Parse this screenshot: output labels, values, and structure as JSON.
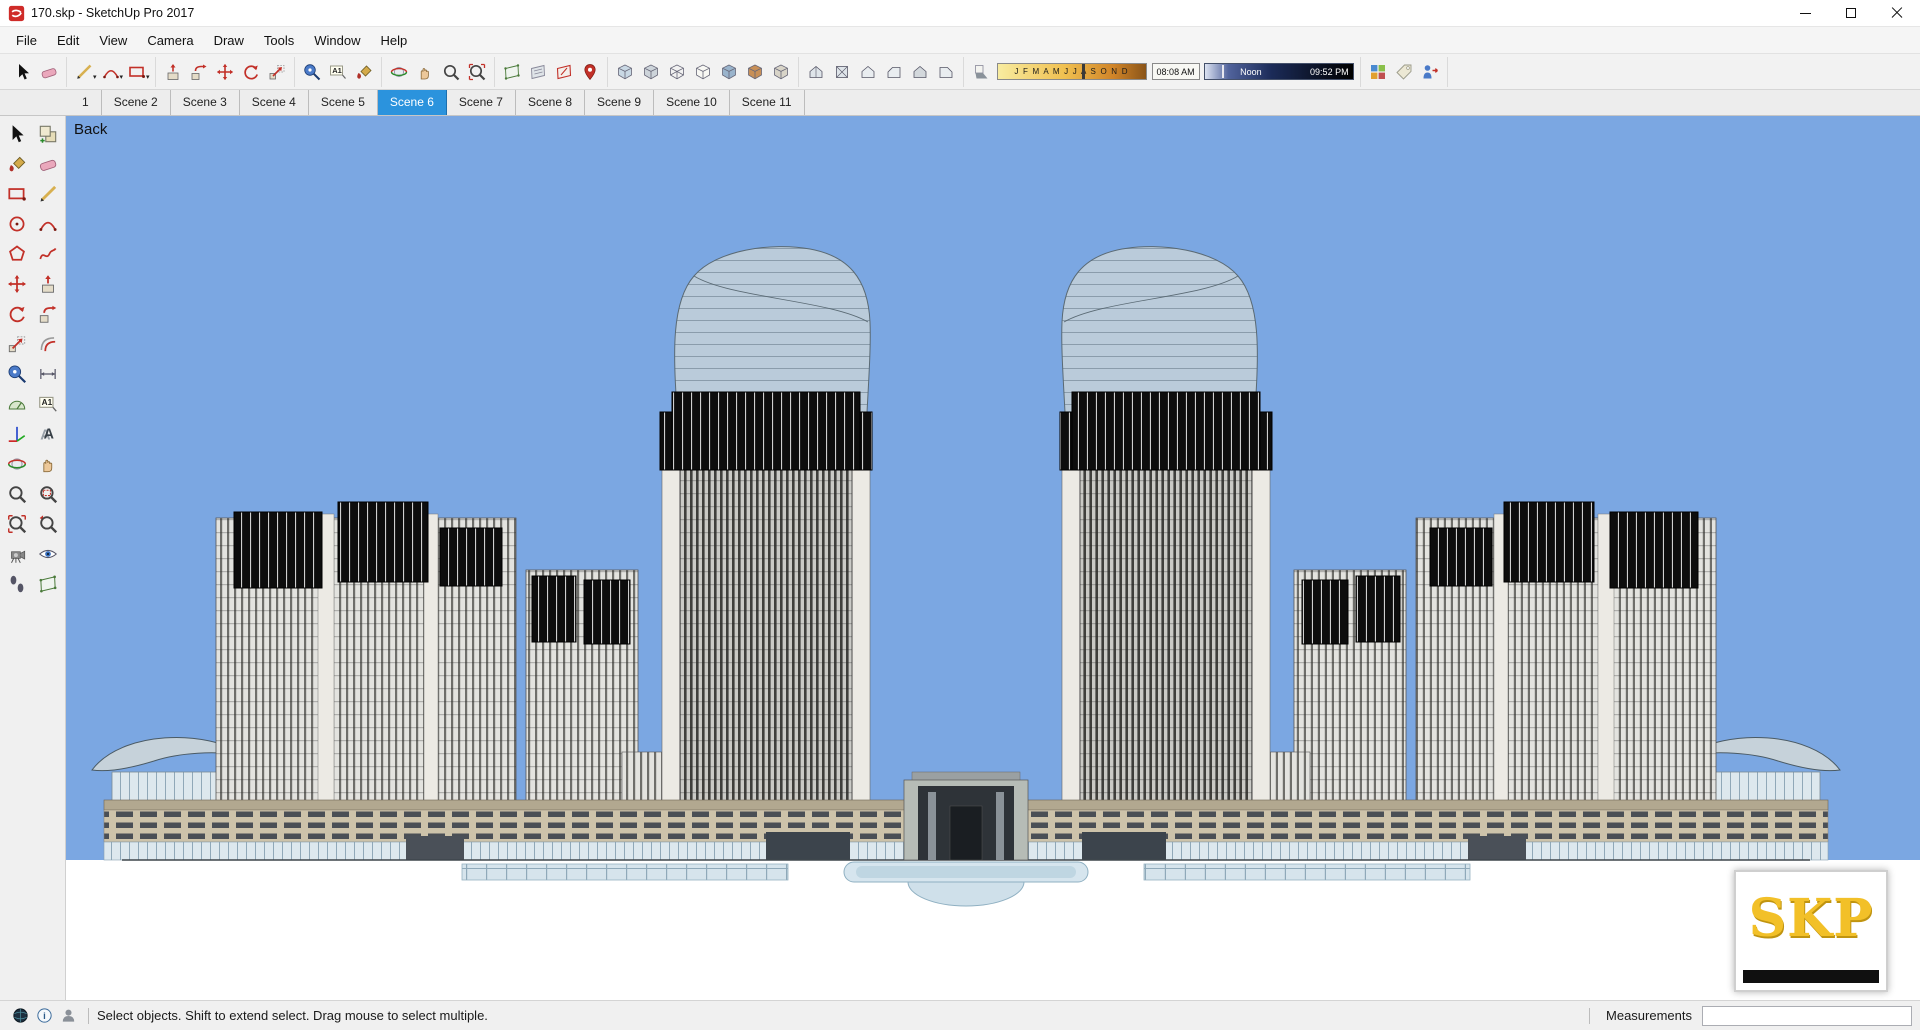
{
  "window": {
    "title": "170.skp - SketchUp Pro 2017",
    "controls": [
      "minimize",
      "maximize",
      "close"
    ]
  },
  "menu": {
    "items": [
      "File",
      "Edit",
      "View",
      "Camera",
      "Draw",
      "Tools",
      "Window",
      "Help"
    ]
  },
  "toolbar": {
    "groups": [
      [
        "select",
        "eraser"
      ],
      [
        "line|caret",
        "arc|caret",
        "rectangle|caret"
      ],
      [
        "push-pull",
        "follow-me",
        "move",
        "rotate",
        "scale"
      ],
      [
        "tape-measure",
        "text",
        "paint-bucket"
      ],
      [
        "orbit",
        "pan",
        "zoom",
        "zoom-extents"
      ],
      [
        "section-plane",
        "section-display",
        "section-cut",
        "location-pin"
      ],
      [
        "style-xray",
        "style-backedges",
        "style-wireframe",
        "style-hiddenline",
        "style-shaded",
        "style-textured",
        "style-monochrome"
      ],
      [
        "view-iso",
        "view-top",
        "view-front",
        "view-right",
        "view-back",
        "view-left"
      ],
      [
        "SHADOW"
      ],
      [
        "warehouse",
        "tag",
        "import-model"
      ]
    ],
    "shadow": {
      "months": "J F M A M J J A S O N D",
      "time_current": "08:08 AM",
      "noon_label": "Noon",
      "time_end": "09:52 PM"
    }
  },
  "scene_tabs": [
    {
      "label": "1",
      "active": false
    },
    {
      "label": "Scene 2",
      "active": false
    },
    {
      "label": "Scene 3",
      "active": false
    },
    {
      "label": "Scene 4",
      "active": false
    },
    {
      "label": "Scene 5",
      "active": false
    },
    {
      "label": "Scene 6",
      "active": true
    },
    {
      "label": "Scene 7",
      "active": false
    },
    {
      "label": "Scene 8",
      "active": false
    },
    {
      "label": "Scene 9",
      "active": false
    },
    {
      "label": "Scene 10",
      "active": false
    },
    {
      "label": "Scene 11",
      "active": false
    }
  ],
  "left_palette": {
    "rows": [
      [
        "select",
        "make-component"
      ],
      [
        "paint-bucket",
        "eraser"
      ],
      [
        "rectangle",
        "line"
      ],
      [
        "circle",
        "arc"
      ],
      [
        "polygon",
        "freehand"
      ],
      [
        "move",
        "push-pull"
      ],
      [
        "rotate",
        "follow-me"
      ],
      [
        "scale",
        "offset"
      ],
      [
        "tape-measure",
        "dimension"
      ],
      [
        "protractor",
        "text"
      ],
      [
        "axes",
        "3d-text"
      ],
      [
        "orbit",
        "pan"
      ],
      [
        "zoom",
        "zoom-window"
      ],
      [
        "zoom-extents",
        "zoom-previous"
      ],
      [
        "position-camera",
        "look-around"
      ],
      [
        "walk",
        "section-plane"
      ]
    ]
  },
  "viewport": {
    "back_label": "Back",
    "watermark": "SKP",
    "sky_color": "#7BA7E2"
  },
  "status_bar": {
    "icons": [
      "geolocation",
      "credits",
      "sign-in"
    ],
    "message": "Select objects. Shift to extend select. Drag mouse to select multiple.",
    "measurements_label": "Measurements",
    "measurements_value": ""
  }
}
